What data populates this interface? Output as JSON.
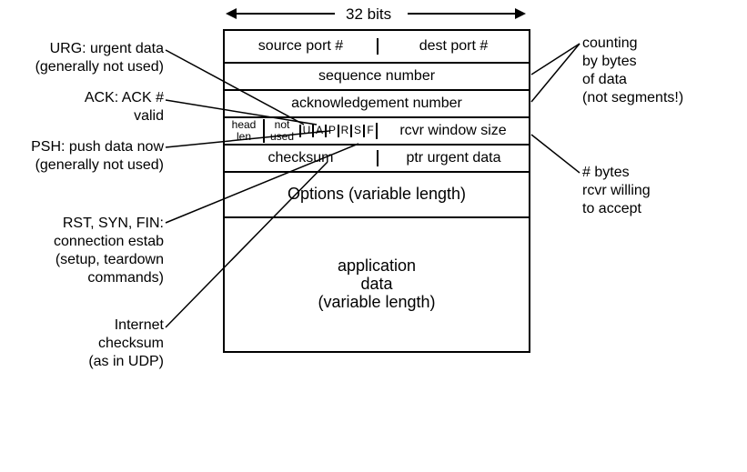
{
  "header": {
    "bits": "32 bits"
  },
  "fields": {
    "source_port": "source port #",
    "dest_port": "dest port #",
    "sequence": "sequence number",
    "ack": "acknowledgement number",
    "head_len_1": "head",
    "head_len_2": "len",
    "not_used_1": "not",
    "not_used_2": "used",
    "flags": {
      "u": "U",
      "a": "A",
      "p": "P",
      "r": "R",
      "s": "S",
      "f": "F"
    },
    "rcvr_window": "rcvr window size",
    "checksum": "checksum",
    "ptr_urgent": "ptr urgent data",
    "options": "Options (variable length)",
    "app_data_1": "application",
    "app_data_2": "data",
    "app_data_3": "(variable length)"
  },
  "annotations": {
    "urg_1": "URG: urgent data",
    "urg_2": "(generally not used)",
    "ackv_1": "ACK: ACK #",
    "ackv_2": "valid",
    "psh_1": "PSH: push data now",
    "psh_2": "(generally not used)",
    "rsf_1": "RST, SYN, FIN:",
    "rsf_2": "connection estab",
    "rsf_3": "(setup, teardown",
    "rsf_4": "commands)",
    "ick_1": "Internet",
    "ick_2": "checksum",
    "ick_3": "(as in UDP)",
    "count_1": "counting",
    "count_2": "by bytes",
    "count_3": "of data",
    "count_4": "(not segments!)",
    "win_1": "# bytes",
    "win_2": "rcvr willing",
    "win_3": "to accept"
  }
}
